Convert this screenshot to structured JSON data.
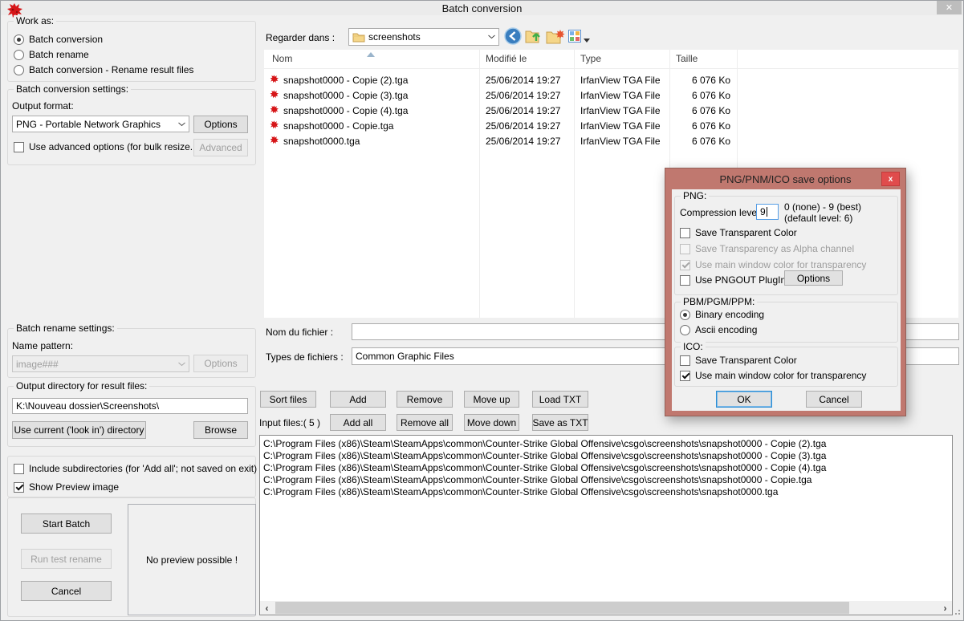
{
  "colors": {
    "window_bg": "#f0f0f0",
    "titlebar_bg": "#ebebeb",
    "dialog_accent": "#c0786f",
    "dialog_close_red": "#e04c4c",
    "irfanview_red": "#d61518",
    "focus_blue": "#569de5"
  },
  "window": {
    "title": "Batch conversion"
  },
  "work_as": {
    "legend": "Work as:",
    "options": [
      {
        "label": "Batch conversion"
      },
      {
        "label": "Batch rename"
      },
      {
        "label": "Batch conversion - Rename result files"
      }
    ]
  },
  "conversion_settings": {
    "legend": "Batch conversion settings:",
    "output_format_label": "Output format:",
    "output_format_value": "PNG - Portable Network Graphics",
    "options_button": "Options",
    "advanced_checkbox_label": "Use advanced options (for bulk resize...)",
    "advanced_button": "Advanced"
  },
  "browser": {
    "look_in_label": "Regarder dans :",
    "folder_value": "screenshots",
    "columns": {
      "name": "Nom",
      "modified": "Modifié le",
      "type": "Type",
      "size": "Taille"
    },
    "rows": [
      {
        "name": "snapshot0000 - Copie (2).tga",
        "modified": "25/06/2014 19:27",
        "type": "IrfanView TGA File",
        "size": "6 076 Ko"
      },
      {
        "name": "snapshot0000 - Copie (3).tga",
        "modified": "25/06/2014 19:27",
        "type": "IrfanView TGA File",
        "size": "6 076 Ko"
      },
      {
        "name": "snapshot0000 - Copie (4).tga",
        "modified": "25/06/2014 19:27",
        "type": "IrfanView TGA File",
        "size": "6 076 Ko"
      },
      {
        "name": "snapshot0000 - Copie.tga",
        "modified": "25/06/2014 19:27",
        "type": "IrfanView TGA File",
        "size": "6 076 Ko"
      },
      {
        "name": "snapshot0000.tga",
        "modified": "25/06/2014 19:27",
        "type": "IrfanView TGA File",
        "size": "6 076 Ko"
      }
    ]
  },
  "file_form": {
    "file_name_label": "Nom du fichier :",
    "file_name_value": "",
    "file_type_label": "Types de fichiers :",
    "file_type_value": "Common Graphic Files"
  },
  "list_actions": {
    "sort_files": "Sort files",
    "add": "Add",
    "remove": "Remove",
    "move_up": "Move up",
    "load_txt": "Load TXT",
    "add_all": "Add all",
    "remove_all": "Remove all",
    "move_down": "Move down",
    "save_as_txt": "Save as TXT",
    "input_files_label": "Input files:( 5 )"
  },
  "input_files": [
    "C:\\Program Files (x86)\\Steam\\SteamApps\\common\\Counter-Strike Global Offensive\\csgo\\screenshots\\snapshot0000 - Copie (2).tga",
    "C:\\Program Files (x86)\\Steam\\SteamApps\\common\\Counter-Strike Global Offensive\\csgo\\screenshots\\snapshot0000 - Copie (3).tga",
    "C:\\Program Files (x86)\\Steam\\SteamApps\\common\\Counter-Strike Global Offensive\\csgo\\screenshots\\snapshot0000 - Copie (4).tga",
    "C:\\Program Files (x86)\\Steam\\SteamApps\\common\\Counter-Strike Global Offensive\\csgo\\screenshots\\snapshot0000 - Copie.tga",
    "C:\\Program Files (x86)\\Steam\\SteamApps\\common\\Counter-Strike Global Offensive\\csgo\\screenshots\\snapshot0000.tga"
  ],
  "rename_settings": {
    "legend": "Batch rename settings:",
    "name_pattern_label": "Name pattern:",
    "name_pattern_value": "image###",
    "options_button": "Options"
  },
  "output_dir": {
    "legend": "Output directory for result files:",
    "value": "K:\\Nouveau dossier\\Screenshots\\",
    "use_current_button": "Use current ('look in') directory",
    "browse_button": "Browse"
  },
  "misc_options": {
    "include_subdirs_label": "Include subdirectories (for 'Add all'; not saved on exit)",
    "show_preview_label": "Show Preview image"
  },
  "bottom": {
    "start_batch": "Start Batch",
    "run_test_rename": "Run test rename",
    "cancel": "Cancel",
    "preview_text": "No preview possible !"
  },
  "png_dialog": {
    "title": "PNG/PNM/ICO save options",
    "png": {
      "legend": "PNG:",
      "compression_label": "Compression level:",
      "compression_value": "9",
      "range_hint": "0 (none) - 9 (best)",
      "default_hint": "(default level: 6)",
      "save_transparent_label": "Save Transparent Color",
      "alpha_label": "Save Transparency as Alpha channel",
      "main_window_label": "Use main window color for transparency",
      "pngout_label": "Use PNGOUT PlugIn",
      "options_button": "Options"
    },
    "pbm": {
      "legend": "PBM/PGM/PPM:",
      "binary_label": "Binary encoding",
      "ascii_label": "Ascii encoding"
    },
    "ico": {
      "legend": "ICO:",
      "save_transparent_label": "Save Transparent Color",
      "main_window_label": "Use main window color for transparency"
    },
    "ok_button": "OK",
    "cancel_button": "Cancel"
  }
}
